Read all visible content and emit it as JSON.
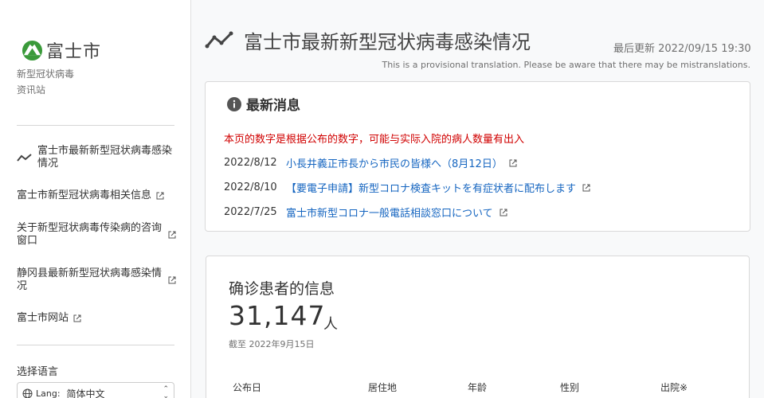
{
  "sidebar": {
    "logo_text": "富士市",
    "site_name_line1": "新型冠状病毒",
    "site_name_line2": "资讯站",
    "nav": [
      {
        "label": "富士市最新新型冠状病毒感染情况"
      },
      {
        "label": "富士市新型冠状病毒相关信息"
      },
      {
        "label": "关于新型冠状病毒传染病的咨询窗口"
      },
      {
        "label": "静冈县最新新型冠状病毒感染情况"
      },
      {
        "label": "富士市网站"
      }
    ],
    "language_title": "选择语言",
    "language_select": {
      "label": "Lang:",
      "value": "简体中文"
    }
  },
  "header": {
    "title": "富士市最新新型冠状病毒感染情况",
    "last_update": "最后更新 2022/09/15 19:30",
    "translation_note": "This is a provisional translation. Please be aware that there may be mistranslations."
  },
  "news": {
    "title": "最新消息",
    "warning": "本页的数字是根据公布的数字，可能与实际入院的病人数量有出入",
    "items": [
      {
        "date": "2022/8/12",
        "text": "小長井義正市長から市民の皆様へ（8月12日）"
      },
      {
        "date": "2022/8/10",
        "text": "【要電子申請】新型コロナ検査キットを有症状者に配布します"
      },
      {
        "date": "2022/7/25",
        "text": "富士市新型コロナ一般電話相談窓口について"
      }
    ]
  },
  "patients": {
    "title": "确诊患者的信息",
    "count": "31,147",
    "unit": "人",
    "as_of": "截至 2022年9月15日",
    "columns": [
      "公布日",
      "居住地",
      "年龄",
      "性别",
      "出院※"
    ]
  },
  "colors": {
    "link": "#1565c0",
    "warning": "#d00000",
    "logo_green": "#3a9a3a"
  },
  "icons": {
    "header": "line-chart-icon",
    "news": "info-icon",
    "external": "external-link-icon",
    "language": "globe-icon"
  }
}
